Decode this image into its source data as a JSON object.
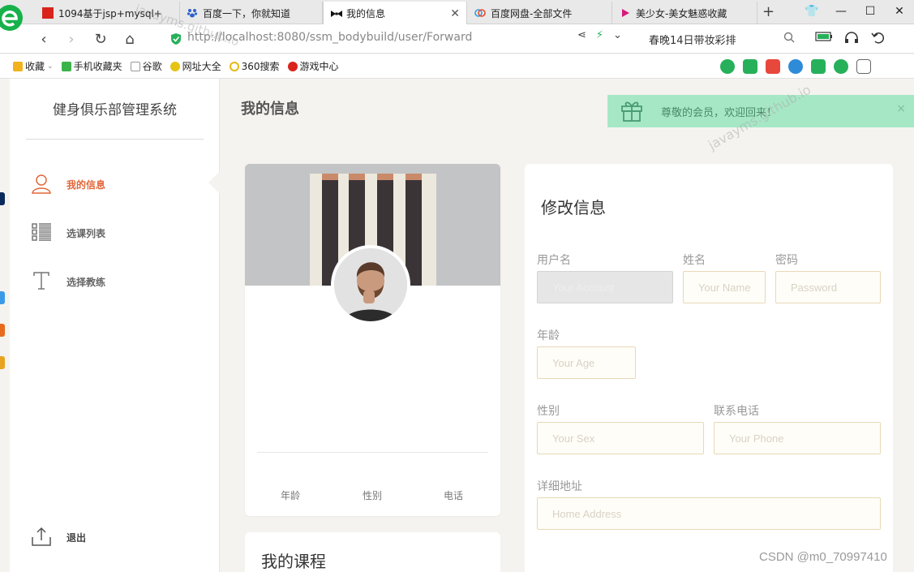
{
  "browser": {
    "tabs": [
      {
        "title": "1094基于jsp+mysql+",
        "active": false
      },
      {
        "title": "百度一下，你就知道",
        "active": false
      },
      {
        "title": "我的信息",
        "active": true
      },
      {
        "title": "百度网盘-全部文件",
        "active": false
      },
      {
        "title": "美少女-美女魅惑收藏",
        "active": false
      }
    ],
    "url_host": "http://localhost",
    "url_path": ":8080/ssm_bodybuild/user/Forward",
    "search_text": "春晚14日带妆彩排",
    "bookmarks": [
      "收藏",
      "手机收藏夹",
      "谷歌",
      "网址大全",
      "360搜索",
      "游戏中心"
    ]
  },
  "sidebar": {
    "brand": "健身俱乐部管理系统",
    "items": [
      {
        "label": "我的信息",
        "icon": "user-icon",
        "active": true
      },
      {
        "label": "选课列表",
        "icon": "list-icon",
        "active": false
      },
      {
        "label": "选择教练",
        "icon": "text-icon",
        "active": false
      }
    ],
    "logout": "退出"
  },
  "page": {
    "title": "我的信息"
  },
  "toast": {
    "message": "尊敬的会员，欢迎回来！",
    "icon": "gift-icon",
    "close": "×"
  },
  "watermark": "javayms.github.io",
  "profile": {
    "stats": [
      "年龄",
      "性别",
      "电话"
    ]
  },
  "courses": {
    "title": "我的课程"
  },
  "form": {
    "title": "修改信息",
    "fields": {
      "account": {
        "label": "用户名",
        "placeholder": "Your Account"
      },
      "name": {
        "label": "姓名",
        "placeholder": "Your Name"
      },
      "password": {
        "label": "密码",
        "placeholder": "Password"
      },
      "age": {
        "label": "年龄",
        "placeholder": "Your Age"
      },
      "sex": {
        "label": "性别",
        "placeholder": "Your Sex"
      },
      "phone": {
        "label": "联系电话",
        "placeholder": "Your Phone"
      },
      "address": {
        "label": "详细地址",
        "placeholder": "Home Address"
      }
    }
  },
  "footer_credit": "CSDN @m0_70997410",
  "colors": {
    "accent": "#e2673a",
    "toast_bg": "#a6e8c6",
    "toast_text": "#4a8a69",
    "input_border": "#e8d8b8"
  }
}
